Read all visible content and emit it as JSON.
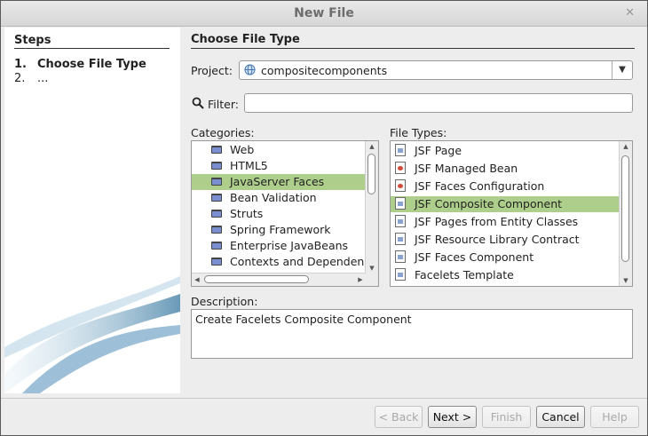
{
  "window": {
    "title": "New File"
  },
  "steps": {
    "title": "Steps",
    "items": [
      {
        "num": "1.",
        "label": "Choose File Type"
      },
      {
        "num": "2.",
        "label": "..."
      }
    ]
  },
  "main": {
    "title": "Choose File Type",
    "project_label": "Project:",
    "project_value": "compositecomponents",
    "filter_label": "Filter:",
    "filter_value": "",
    "categories_label": "Categories:",
    "categories": [
      "Web",
      "HTML5",
      "JavaServer Faces",
      "Bean Validation",
      "Struts",
      "Spring Framework",
      "Enterprise JavaBeans",
      "Contexts and Dependency Injection"
    ],
    "selected_category": "JavaServer Faces",
    "file_types_label": "File Types:",
    "file_types": [
      "JSF Page",
      "JSF Managed Bean",
      "JSF Faces Configuration",
      "JSF Composite Component",
      "JSF Pages from Entity Classes",
      "JSF Resource Library Contract",
      "JSF Faces Component",
      "Facelets Template"
    ],
    "selected_file_type": "JSF Composite Component",
    "description_label": "Description:",
    "description_text": "Create Facelets Composite Component"
  },
  "buttons": {
    "back": "< Back",
    "next": "Next >",
    "finish": "Finish",
    "cancel": "Cancel",
    "help": "Help"
  },
  "colors": {
    "selection": "#aecf8b"
  },
  "icons": {
    "folder": "folder-icon",
    "file": "file-icon",
    "globe": "globe-icon",
    "search": "search-icon"
  }
}
